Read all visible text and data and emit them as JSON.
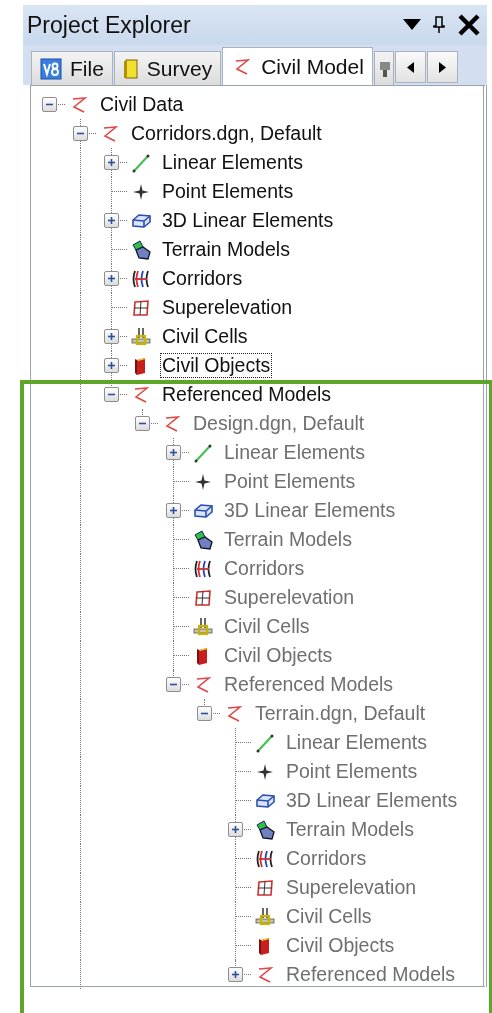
{
  "title_bar": {
    "title": "Project Explorer"
  },
  "tabs": [
    {
      "kind": "file",
      "label": "File",
      "selected": false
    },
    {
      "kind": "survey",
      "label": "Survey",
      "selected": false
    },
    {
      "kind": "civil",
      "label": "Civil Model",
      "selected": true
    },
    {
      "kind": "partial",
      "selected": false
    }
  ],
  "tree": [
    {
      "label": "Civil Data",
      "kind": "civil",
      "expanded": true,
      "dimmed": false,
      "focused": false,
      "more_below": true,
      "children": [
        {
          "label": "Corridors.dgn, Default",
          "kind": "civil",
          "expanded": true,
          "dimmed": false,
          "focused": false,
          "children": [
            {
              "label": "Linear Elements",
              "kind": "linear",
              "expanded": false,
              "dimmed": false,
              "focused": false
            },
            {
              "label": "Point Elements",
              "kind": "point",
              "dimmed": false,
              "focused": false
            },
            {
              "label": "3D Linear Elements",
              "kind": "linear3d",
              "expanded": false,
              "dimmed": false,
              "focused": false
            },
            {
              "label": "Terrain Models",
              "kind": "terrain",
              "dimmed": false,
              "focused": false
            },
            {
              "label": "Corridors",
              "kind": "corridors",
              "expanded": false,
              "dimmed": false,
              "focused": false
            },
            {
              "label": "Superelevation",
              "kind": "superelevation",
              "dimmed": false,
              "focused": false
            },
            {
              "label": "Civil Cells",
              "kind": "cells",
              "expanded": false,
              "dimmed": false,
              "focused": false
            },
            {
              "label": "Civil Objects",
              "kind": "objects",
              "expanded": false,
              "dimmed": false,
              "focused": true
            },
            {
              "label": "Referenced Models",
              "kind": "civil",
              "expanded": true,
              "dimmed": false,
              "focused": false,
              "highlighted": true,
              "children": [
                {
                  "label": "Design.dgn, Default",
                  "kind": "civil",
                  "expanded": true,
                  "dimmed": true,
                  "focused": false,
                  "children": [
                    {
                      "label": "Linear Elements",
                      "kind": "linear",
                      "expanded": false,
                      "dimmed": true,
                      "focused": false
                    },
                    {
                      "label": "Point Elements",
                      "kind": "point",
                      "dimmed": true,
                      "focused": false
                    },
                    {
                      "label": "3D Linear Elements",
                      "kind": "linear3d",
                      "expanded": false,
                      "dimmed": true,
                      "focused": false
                    },
                    {
                      "label": "Terrain Models",
                      "kind": "terrain",
                      "dimmed": true,
                      "focused": false
                    },
                    {
                      "label": "Corridors",
                      "kind": "corridors",
                      "dimmed": true,
                      "focused": false
                    },
                    {
                      "label": "Superelevation",
                      "kind": "superelevation",
                      "dimmed": true,
                      "focused": false
                    },
                    {
                      "label": "Civil Cells",
                      "kind": "cells",
                      "dimmed": true,
                      "focused": false
                    },
                    {
                      "label": "Civil Objects",
                      "kind": "objects",
                      "dimmed": true,
                      "focused": false
                    },
                    {
                      "label": "Referenced Models",
                      "kind": "civil",
                      "expanded": true,
                      "dimmed": true,
                      "focused": false,
                      "children": [
                        {
                          "label": "Terrain.dgn, Default",
                          "kind": "civil",
                          "expanded": true,
                          "dimmed": true,
                          "focused": false,
                          "children": [
                            {
                              "label": "Linear Elements",
                              "kind": "linear",
                              "dimmed": true,
                              "focused": false
                            },
                            {
                              "label": "Point Elements",
                              "kind": "point",
                              "dimmed": true,
                              "focused": false
                            },
                            {
                              "label": "3D Linear Elements",
                              "kind": "linear3d",
                              "dimmed": true,
                              "focused": false
                            },
                            {
                              "label": "Terrain Models",
                              "kind": "terrain",
                              "expanded": false,
                              "dimmed": true,
                              "focused": false
                            },
                            {
                              "label": "Corridors",
                              "kind": "corridors",
                              "dimmed": true,
                              "focused": false
                            },
                            {
                              "label": "Superelevation",
                              "kind": "superelevation",
                              "dimmed": true,
                              "focused": false
                            },
                            {
                              "label": "Civil Cells",
                              "kind": "cells",
                              "dimmed": true,
                              "focused": false
                            },
                            {
                              "label": "Civil Objects",
                              "kind": "objects",
                              "dimmed": true,
                              "focused": false
                            },
                            {
                              "label": "Referenced Models",
                              "kind": "civil",
                              "expanded": false,
                              "dimmed": true,
                              "focused": false
                            }
                          ]
                        }
                      ]
                    }
                  ]
                }
              ]
            }
          ]
        }
      ]
    }
  ]
}
